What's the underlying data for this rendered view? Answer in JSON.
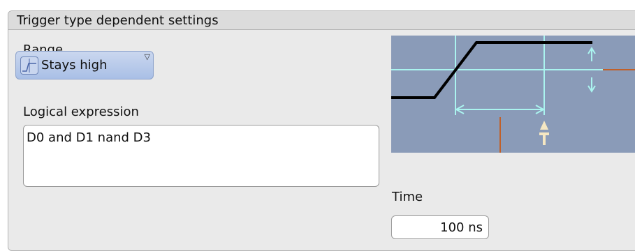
{
  "panel": {
    "title": "Trigger type dependent settings"
  },
  "range": {
    "label": "Range",
    "selected": "Stays high",
    "icon": "stays-high-pulse-icon"
  },
  "logical_expression": {
    "label": "Logical expression",
    "value": "D0 and D1 nand D3"
  },
  "time": {
    "label": "Time",
    "value": "100 ns"
  },
  "diagram": {
    "background_color": "#8a9bb8",
    "guide_color": "#aaf4ef",
    "signal_color": "#000000",
    "marker_color": "#c0602a"
  }
}
